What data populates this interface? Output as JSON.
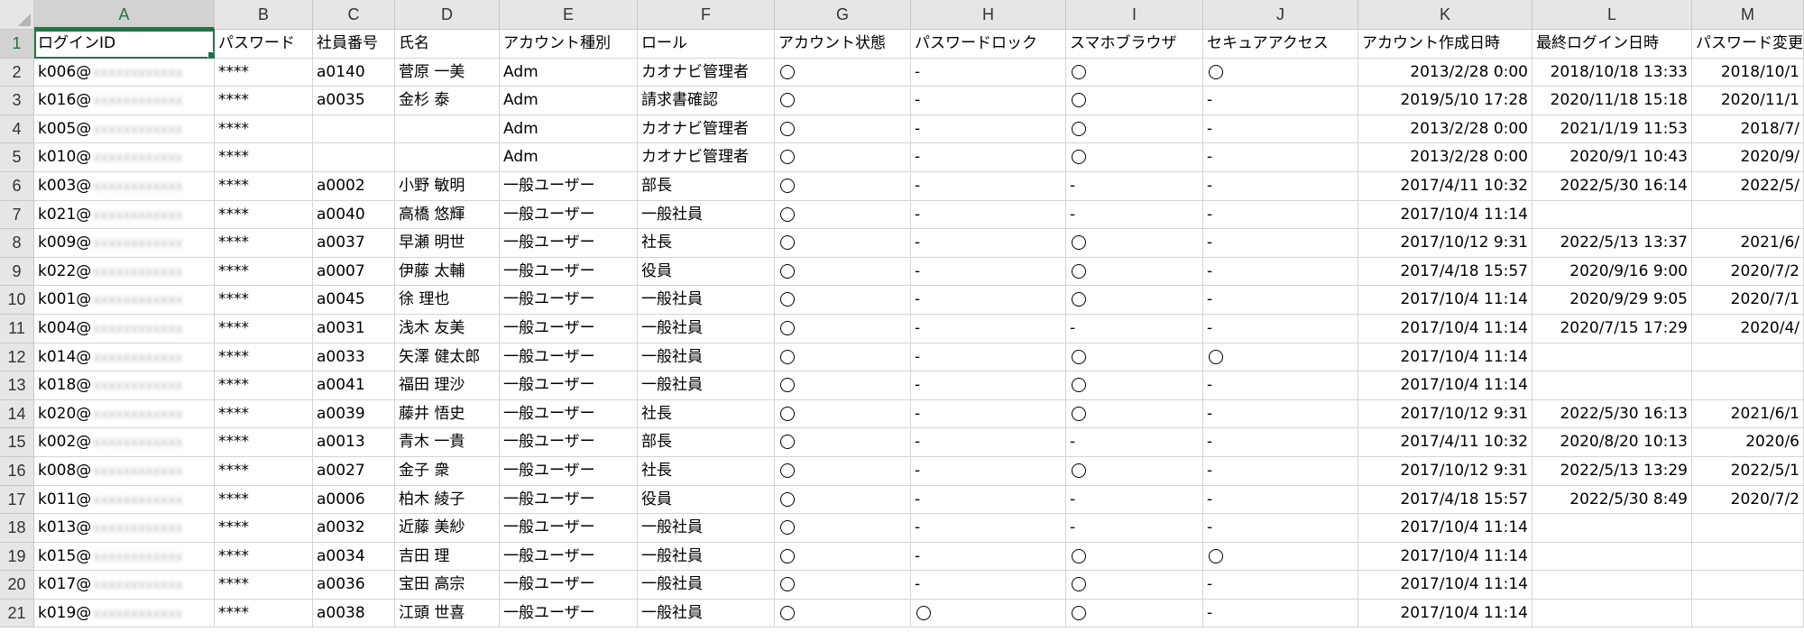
{
  "columns": [
    "A",
    "B",
    "C",
    "D",
    "E",
    "F",
    "G",
    "H",
    "I",
    "J",
    "K",
    "L",
    "M"
  ],
  "active_column": 0,
  "active_row": 1,
  "circle_mark": "〇",
  "rows": [
    {
      "n": "1",
      "cells": [
        "ログインID",
        "パスワード",
        "社員番号",
        "氏名",
        "アカウント種別",
        "ロール",
        "アカウント状態",
        "パスワードロック",
        "スマホブラウザ",
        "セキュアアクセス",
        "アカウント作成日時",
        "最終ログイン日時",
        "パスワード変更"
      ]
    },
    {
      "n": "2",
      "cells": [
        "k006@",
        "****",
        "a0140",
        "菅原 一美",
        "Adm",
        "カオナビ管理者",
        "〇",
        "-",
        "〇",
        "〇",
        "2013/2/28 0:00",
        "2018/10/18 13:33",
        "2018/10/1"
      ]
    },
    {
      "n": "3",
      "cells": [
        "k016@",
        "****",
        "a0035",
        "金杉 泰",
        "Adm",
        "請求書確認",
        "〇",
        "-",
        "〇",
        "-",
        "2019/5/10 17:28",
        "2020/11/18 15:18",
        "2020/11/1"
      ]
    },
    {
      "n": "4",
      "cells": [
        "k005@",
        "****",
        "",
        "",
        "Adm",
        "カオナビ管理者",
        "〇",
        "-",
        "〇",
        "-",
        "2013/2/28 0:00",
        "2021/1/19 11:53",
        "2018/7/"
      ]
    },
    {
      "n": "5",
      "cells": [
        "k010@",
        "****",
        "",
        "",
        "Adm",
        "カオナビ管理者",
        "〇",
        "-",
        "〇",
        "-",
        "2013/2/28 0:00",
        "2020/9/1 10:43",
        "2020/9/"
      ]
    },
    {
      "n": "6",
      "cells": [
        "k003@",
        "****",
        "a0002",
        "小野 敏明",
        "一般ユーザー",
        "部長",
        "〇",
        "-",
        "-",
        "-",
        "2017/4/11 10:32",
        "2022/5/30 16:14",
        "2022/5/"
      ]
    },
    {
      "n": "7",
      "cells": [
        "k021@",
        "****",
        "a0040",
        "高橋 悠輝",
        "一般ユーザー",
        "一般社員",
        "〇",
        "-",
        "-",
        "-",
        "2017/10/4 11:14",
        "",
        ""
      ]
    },
    {
      "n": "8",
      "cells": [
        "k009@",
        "****",
        "a0037",
        "早瀬 明世",
        "一般ユーザー",
        "社長",
        "〇",
        "-",
        "〇",
        "-",
        "2017/10/12 9:31",
        "2022/5/13 13:37",
        "2021/6/"
      ]
    },
    {
      "n": "9",
      "cells": [
        "k022@",
        "****",
        "a0007",
        "伊藤 太輔",
        "一般ユーザー",
        "役員",
        "〇",
        "-",
        "〇",
        "-",
        "2017/4/18 15:57",
        "2020/9/16 9:00",
        "2020/7/2"
      ]
    },
    {
      "n": "10",
      "cells": [
        "k001@",
        "****",
        "a0045",
        "徐 理也",
        "一般ユーザー",
        "一般社員",
        "〇",
        "-",
        "〇",
        "-",
        "2017/10/4 11:14",
        "2020/9/29 9:05",
        "2020/7/1"
      ]
    },
    {
      "n": "11",
      "cells": [
        "k004@",
        "****",
        "a0031",
        "浅木 友美",
        "一般ユーザー",
        "一般社員",
        "〇",
        "-",
        "-",
        "-",
        "2017/10/4 11:14",
        "2020/7/15 17:29",
        "2020/4/"
      ]
    },
    {
      "n": "12",
      "cells": [
        "k014@",
        "****",
        "a0033",
        "矢澤 健太郎",
        "一般ユーザー",
        "一般社員",
        "〇",
        "-",
        "〇",
        "〇",
        "2017/10/4 11:14",
        "",
        ""
      ]
    },
    {
      "n": "13",
      "cells": [
        "k018@",
        "****",
        "a0041",
        "福田 理沙",
        "一般ユーザー",
        "一般社員",
        "〇",
        "-",
        "〇",
        "-",
        "2017/10/4 11:14",
        "",
        ""
      ]
    },
    {
      "n": "14",
      "cells": [
        "k020@",
        "****",
        "a0039",
        "藤井 悟史",
        "一般ユーザー",
        "社長",
        "〇",
        "-",
        "〇",
        "-",
        "2017/10/12 9:31",
        "2022/5/30 16:13",
        "2021/6/1"
      ]
    },
    {
      "n": "15",
      "cells": [
        "k002@",
        "****",
        "a0013",
        "青木 一貴",
        "一般ユーザー",
        "部長",
        "〇",
        "-",
        "-",
        "-",
        "2017/4/11 10:32",
        "2020/8/20 10:13",
        "2020/6"
      ]
    },
    {
      "n": "16",
      "cells": [
        "k008@",
        "****",
        "a0027",
        "金子 衆",
        "一般ユーザー",
        "社長",
        "〇",
        "-",
        "〇",
        "-",
        "2017/10/12 9:31",
        "2022/5/13 13:29",
        "2022/5/1"
      ]
    },
    {
      "n": "17",
      "cells": [
        "k011@",
        "****",
        "a0006",
        "柏木 綾子",
        "一般ユーザー",
        "役員",
        "〇",
        "-",
        "-",
        "-",
        "2017/4/18 15:57",
        "2022/5/30 8:49",
        "2020/7/2"
      ]
    },
    {
      "n": "18",
      "cells": [
        "k013@",
        "****",
        "a0032",
        "近藤 美紗",
        "一般ユーザー",
        "一般社員",
        "〇",
        "-",
        "-",
        "-",
        "2017/10/4 11:14",
        "",
        ""
      ]
    },
    {
      "n": "19",
      "cells": [
        "k015@",
        "****",
        "a0034",
        "吉田 理",
        "一般ユーザー",
        "一般社員",
        "〇",
        "-",
        "〇",
        "〇",
        "2017/10/4 11:14",
        "",
        ""
      ]
    },
    {
      "n": "20",
      "cells": [
        "k017@",
        "****",
        "a0036",
        "宝田 高宗",
        "一般ユーザー",
        "一般社員",
        "〇",
        "-",
        "〇",
        "-",
        "2017/10/4 11:14",
        "",
        ""
      ]
    },
    {
      "n": "21",
      "cells": [
        "k019@",
        "****",
        "a0038",
        "江頭 世喜",
        "一般ユーザー",
        "一般社員",
        "〇",
        "〇",
        "〇",
        "-",
        "2017/10/4 11:14",
        "",
        ""
      ]
    }
  ]
}
